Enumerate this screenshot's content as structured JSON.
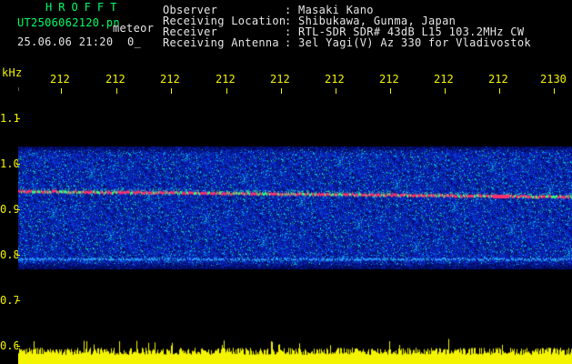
{
  "header": {
    "brand": "HROFFT",
    "filename": "UT2506062120.pn",
    "mode_label": "meteor",
    "datetime": "25.06.06 21:20",
    "indicator": "0_"
  },
  "info": {
    "labels": [
      "Observer",
      "Receiving Location",
      "Receiver",
      "Receiving Antenna"
    ],
    "values": [
      ": Masaki Kano",
      ": Shibukawa, Gunma, Japan",
      ": RTL-SDR SDR# 43dB L15 103.2MHz CW",
      ": 3el Yagi(V) Az 330 for Vladivostok"
    ]
  },
  "axes": {
    "y_unit": "kHz",
    "y_ticks": [
      "1.1",
      "1.0",
      "0.9",
      "0.8",
      "0.7",
      "0.6"
    ],
    "x_ticks": [
      "212",
      "212",
      "212",
      "212",
      "212",
      "212",
      "212",
      "212",
      "212",
      "2130"
    ]
  },
  "colors": {
    "text_green": "#00ff66",
    "text_white": "#e6e6e6",
    "axis_yellow": "#f4f400",
    "background": "#000000",
    "spectrogram_noise": "#1030c8",
    "signal_line": "#ff3070"
  },
  "spectrogram": {
    "band_top_khz": 1.04,
    "band_bottom_khz": 0.77,
    "carrier_khz": 0.94,
    "secondary_line_khz": 0.79
  }
}
